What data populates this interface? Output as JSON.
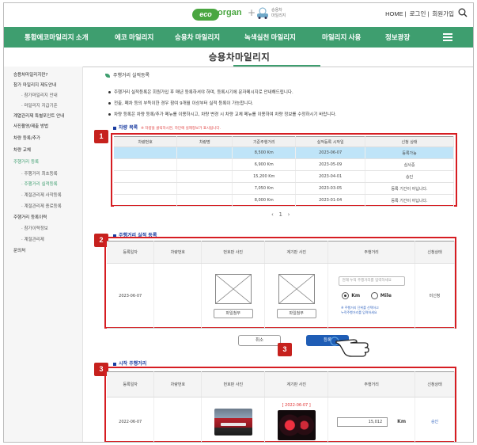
{
  "header": {
    "logo_eco": "eco",
    "logo_organ": "organ",
    "logo_plus": "+",
    "logo_sub_1": "승용차",
    "logo_sub_2": "마일리지",
    "links": [
      "HOME",
      "로그인",
      "회원가입"
    ]
  },
  "gnb": {
    "items": [
      "통합에코마일리지 소개",
      "에코 마일리지",
      "승용차 마일리지",
      "녹색실천 마일리지",
      "마일리지 사용",
      "정보광장"
    ]
  },
  "page": {
    "title": "승용차마일리지"
  },
  "sidebar": {
    "items": [
      {
        "label": "승용차마일리지란?"
      },
      {
        "label": "참가 마일리지 제도안내"
      },
      {
        "label": "· 참가마일리지 안내"
      },
      {
        "label": "· 마일리지 지급기준"
      },
      {
        "label": "계열관리제 특별포인트 안내"
      },
      {
        "label": "사진촬영/제출 방법"
      },
      {
        "label": "차량 등록/추가"
      },
      {
        "label": "차량 교체"
      },
      {
        "label": "주행거리 등록"
      },
      {
        "label": "· 주행거리 최초등록"
      },
      {
        "label": "· 주행거리 실적등록"
      },
      {
        "label": "· 계절관리제 사작등록"
      },
      {
        "label": "· 계절관리제 종료등록"
      },
      {
        "label": "주행거리 등록이력"
      },
      {
        "label": "· 참가이력정보"
      },
      {
        "label": "· 계절관리제"
      },
      {
        "label": "문의처"
      }
    ]
  },
  "content": {
    "section_title": "주행거리 실적등록",
    "notices": [
      "주행거리 실적등록은 회원가입 후 매년 등록하셔야 하며, 등록시기에 문자메시지로 안내해드립니다.",
      "전출, 폐차 등의 부득이한 경우 참여 9개월 이상부터 실적 등록이 가능합니다.",
      "차량 등록은 차량 등록/추가 메뉴를 이용하시고, 차량 변경 시 차량 교체 메뉴를 이용하여 차량 정보를 수정하시기 바랍니다."
    ],
    "vehicle_list": {
      "title": "차량 목록",
      "note": "※ 차량을 클릭하시면, 하단에 실제정보가 표시됩니다.",
      "badge": "1",
      "columns": [
        "차량번호",
        "차량명",
        "기준주행거리",
        "실적등록 시작일",
        "신청 상태"
      ],
      "rows": [
        {
          "no": "",
          "name": "",
          "distance": "8,500 Km",
          "date": "2023-06-07",
          "status": "등록가능"
        },
        {
          "no": "",
          "name": "",
          "distance": "6,900 Km",
          "date": "2023-05-09",
          "status": "심사중"
        },
        {
          "no": "",
          "name": "",
          "distance": "15,200 Km",
          "date": "2023-04-01",
          "status": "승인"
        },
        {
          "no": "",
          "name": "",
          "distance": "7,050 Km",
          "date": "2023-03-05",
          "status": "등록 기간이 아닙니다."
        },
        {
          "no": "",
          "name": "",
          "distance": "8,000 Km",
          "date": "2023-01-04",
          "status": "등록 기간이 아닙니다."
        }
      ],
      "pager_prev": "‹",
      "pager_page": "1",
      "pager_next": "›"
    },
    "register": {
      "title": "주행거리 실적 등록",
      "badge": "2",
      "columns": [
        "등록일자",
        "차량번호",
        "번호판 사진",
        "계기판 사진",
        "주행거리",
        "신청상태"
      ],
      "date": "2023-06-07",
      "vehicle_no": "",
      "file_button_1": "파일첨부",
      "file_button_2": "파일첨부",
      "distance_placeholder": "현재 누적 주행거리를 입력하세요",
      "unit_km": "Km",
      "unit_mile": "Mile",
      "hint_1": "※ 주행거리 단위를 선택하고",
      "hint_2": "누적주행거리를 입력하세요",
      "status": "미신청",
      "cancel_label": "취소",
      "submit_label": "등록",
      "submit_badge": "3"
    },
    "start_distance": {
      "title": "시작 주행거리",
      "badge": "3",
      "columns": [
        "등록일자",
        "차량번호",
        "번호판 사진",
        "계기판 사진",
        "주행거리",
        "신청상태"
      ],
      "date": "2022-06-07",
      "vehicle_no": "",
      "photo_date": "[ 2022-06-07 ]",
      "distance": "15,012",
      "unit": "Km",
      "status": "승인"
    }
  },
  "colors": {
    "brand_green": "#3e9e6f",
    "highlight_red": "#d61d22",
    "selected_row": "#bfe4f8",
    "primary_blue": "#1f5db5"
  }
}
